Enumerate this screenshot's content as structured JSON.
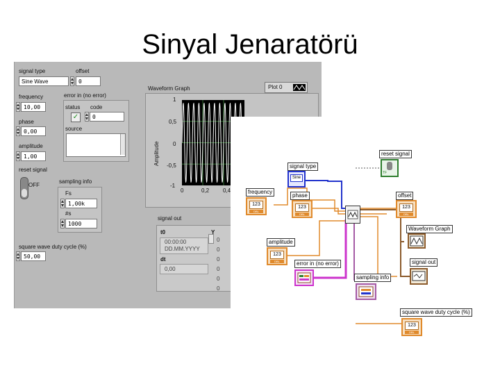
{
  "slide_title": "Sinyal Jenaratörü",
  "front_panel": {
    "signal_type": {
      "label": "signal type",
      "value": "Sine Wave"
    },
    "offset": {
      "label": "offset",
      "value": "0"
    },
    "frequency": {
      "label": "frequency",
      "value": "10,00"
    },
    "phase": {
      "label": "phase",
      "value": "0,00"
    },
    "amplitude": {
      "label": "amplitude",
      "value": "1,00"
    },
    "reset_signal": {
      "label": "reset signal",
      "state": "OFF"
    },
    "error_in": {
      "label": "error in (no error)",
      "status_label": "status",
      "code_label": "code",
      "code_value": "0",
      "source_label": "source"
    },
    "sampling_info": {
      "label": "sampling info",
      "fs_label": "Fs",
      "fs_value": "1,00k",
      "ns_label": "#s",
      "ns_value": "1000"
    },
    "square_wave": {
      "label": "square wave duty cycle (%)",
      "value": "50,00"
    },
    "waveform_graph": {
      "label": "Waveform Graph",
      "plot_legend": "Plot 0",
      "y_axis_label": "Amplitude",
      "y_ticks": [
        "1",
        "0,5",
        "0",
        "-0,5",
        "-1"
      ],
      "x_ticks": [
        "0",
        "0,2",
        "0,4"
      ]
    },
    "signal_out": {
      "label": "signal out",
      "t0_label": "t0",
      "t0_time": "00:00:00",
      "t0_date": "DD.MM.YYYY",
      "dt_label": "dt",
      "dt_value": "0,00",
      "y_label": "Y",
      "y_values": [
        "0",
        "0",
        "0",
        "0",
        "0",
        "0"
      ]
    }
  },
  "block_diagram": {
    "reset_signal": "reset signal",
    "tf_text": "TF",
    "signal_type": "signal type",
    "enum_text": "Sine",
    "frequency": "frequency",
    "phase": "phase",
    "offset": "offset",
    "waveform_graph": "Waveform Graph",
    "amplitude": "amplitude",
    "error_in": "error in (no error)",
    "sampling_info": "sampling info",
    "signal_out": "signal out",
    "square_wave": "square wave duty cycle (%)",
    "num_text": "123",
    "dbl_text": "DBL"
  },
  "colors": {
    "numeric_wire": "#e08a2c",
    "enum_wire": "#2233cc",
    "cluster_wire": "#cc33cc",
    "bool_wire": "#2d7d2d",
    "graph_bg": "#000000",
    "graph_grid": "#2e6b2e",
    "trace": "#ffffff"
  }
}
